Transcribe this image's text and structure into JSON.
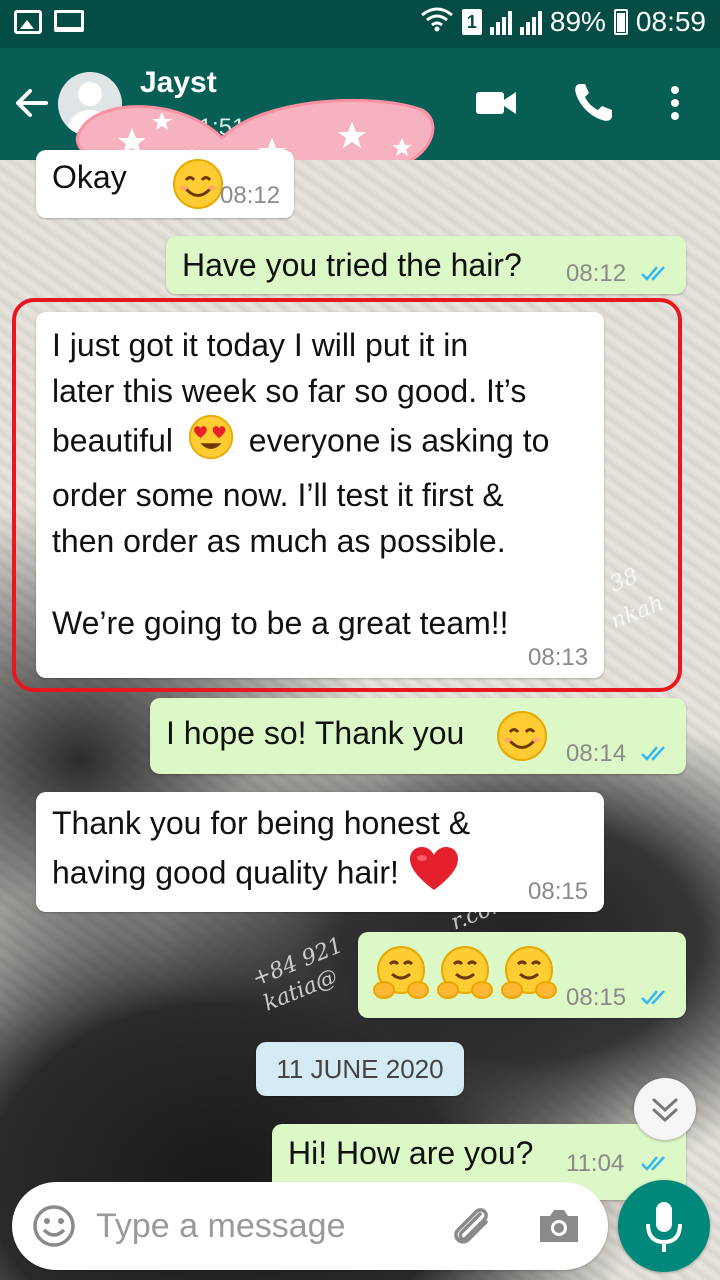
{
  "status_bar": {
    "battery": "89%",
    "time": "08:59",
    "sim_slot": "1"
  },
  "header": {
    "contact_name": "Jayst",
    "last_seen": "la          d 21:51"
  },
  "messages": [
    {
      "direction": "incoming",
      "text": "Okay",
      "emoji": "smiling-face",
      "time": "08:12"
    },
    {
      "direction": "outgoing",
      "text": "Have you tried the hair?",
      "time": "08:12",
      "read": true
    },
    {
      "direction": "incoming",
      "lines": [
        "I just got it today I will put it in",
        "later this week so far so good. It’s",
        "beautiful",
        "everyone is asking to",
        "order some now. I’ll test it first &",
        "then order as much as possible.",
        "We’re going to be a great team!!"
      ],
      "emoji": "heart-eyes-face",
      "time": "08:13",
      "highlighted": true
    },
    {
      "direction": "outgoing",
      "text": "I hope so! Thank you",
      "emoji": "smiling-face",
      "time": "08:14",
      "read": true
    },
    {
      "direction": "incoming",
      "lines": [
        "Thank you for being honest &",
        "having good quality hair!"
      ],
      "emoji": "red-heart",
      "time": "08:15"
    },
    {
      "direction": "outgoing",
      "emoji": "hugging-face x3",
      "time": "08:15",
      "read": true
    },
    {
      "direction": "outgoing",
      "text": "Hi! How are you?",
      "time": "11:04",
      "read": true
    }
  ],
  "date_chip": "11 JUNE 2020",
  "watermarks": [
    "+84 921",
    "katia@",
    "r.com",
    "1 38",
    "nkah"
  ],
  "composer": {
    "placeholder": "Type a message"
  },
  "colors": {
    "header": "#075e54",
    "status_bar": "#054d44",
    "outgoing_bubble": "#dcf8c6",
    "incoming_bubble": "#ffffff",
    "read_ticks": "#34b7f1",
    "mic_button": "#00897b",
    "highlight": "#e8161f"
  }
}
